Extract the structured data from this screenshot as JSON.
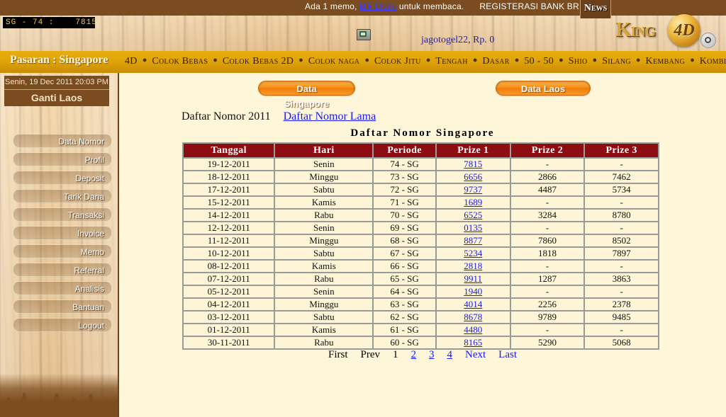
{
  "news": {
    "text_before": "Ada 1 memo, ",
    "link": "klik Disini",
    "text_after": " untuk membaca.",
    "marquee_extra": "REGISTERASI BANK BR",
    "badge": "News"
  },
  "ticker": {
    "label": "SG - 74 :",
    "value": "7815"
  },
  "account": {
    "user_info": "jagotogel22, Rp. 0"
  },
  "logo": {
    "text": "King",
    "badge": "4D"
  },
  "nav": {
    "pasaran": "Pasaran : Singapore",
    "items": [
      "4D",
      "Colok Bebas",
      "Colok Bebas 2D",
      "Colok naga",
      "Colok Jitu",
      "Tengah",
      "Dasar",
      "50 - 50",
      "Shio",
      "Silang",
      "Kembang",
      "Kombinasi"
    ]
  },
  "sidebar": {
    "date": "Senin, 19 Dec 2011 20:03 PM",
    "switch_label": "Ganti Laos",
    "items": [
      "Data Nomor",
      "Profil",
      "Deposit",
      "Tarik Dana",
      "Transaksi",
      "Invoice",
      "Memo",
      "Referral",
      "Analisis",
      "Bantuan",
      "Logout"
    ]
  },
  "tabs": {
    "singapore": "Data Singapore",
    "laos": "Data Laos"
  },
  "main": {
    "daftar_label": "Daftar Nomor 2011",
    "daftar_link": "Daftar Nomor Lama",
    "table_title": "Daftar  Nomor  Singapore"
  },
  "table": {
    "columns": [
      "Tanggal",
      "Hari",
      "Periode",
      "Prize 1",
      "Prize 2",
      "Prize 3"
    ],
    "rows": [
      {
        "tanggal": "19-12-2011",
        "hari": "Senin",
        "periode": "74 - SG",
        "prize1": "7815",
        "prize2": "-",
        "prize3": "-"
      },
      {
        "tanggal": "18-12-2011",
        "hari": "Minggu",
        "periode": "73 - SG",
        "prize1": "6656",
        "prize2": "2866",
        "prize3": "7462"
      },
      {
        "tanggal": "17-12-2011",
        "hari": "Sabtu",
        "periode": "72 - SG",
        "prize1": "9737",
        "prize2": "4487",
        "prize3": "5734"
      },
      {
        "tanggal": "15-12-2011",
        "hari": "Kamis",
        "periode": "71 - SG",
        "prize1": "1689",
        "prize2": "-",
        "prize3": "-"
      },
      {
        "tanggal": "14-12-2011",
        "hari": "Rabu",
        "periode": "70 - SG",
        "prize1": "6525",
        "prize2": "3284",
        "prize3": "8780"
      },
      {
        "tanggal": "12-12-2011",
        "hari": "Senin",
        "periode": "69 - SG",
        "prize1": "0135",
        "prize2": "-",
        "prize3": "-"
      },
      {
        "tanggal": "11-12-2011",
        "hari": "Minggu",
        "periode": "68 - SG",
        "prize1": "8877",
        "prize2": "7860",
        "prize3": "8502"
      },
      {
        "tanggal": "10-12-2011",
        "hari": "Sabtu",
        "periode": "67 - SG",
        "prize1": "5234",
        "prize2": "1818",
        "prize3": "7897"
      },
      {
        "tanggal": "08-12-2011",
        "hari": "Kamis",
        "periode": "66 - SG",
        "prize1": "2818",
        "prize2": "-",
        "prize3": "-"
      },
      {
        "tanggal": "07-12-2011",
        "hari": "Rabu",
        "periode": "65 - SG",
        "prize1": "9911",
        "prize2": "1287",
        "prize3": "3863"
      },
      {
        "tanggal": "05-12-2011",
        "hari": "Senin",
        "periode": "64 - SG",
        "prize1": "1940",
        "prize2": "-",
        "prize3": "-"
      },
      {
        "tanggal": "04-12-2011",
        "hari": "Minggu",
        "periode": "63 - SG",
        "prize1": "4014",
        "prize2": "2256",
        "prize3": "2378"
      },
      {
        "tanggal": "03-12-2011",
        "hari": "Sabtu",
        "periode": "62 - SG",
        "prize1": "8678",
        "prize2": "9789",
        "prize3": "9485"
      },
      {
        "tanggal": "01-12-2011",
        "hari": "Kamis",
        "periode": "61 - SG",
        "prize1": "4480",
        "prize2": "-",
        "prize3": "-"
      },
      {
        "tanggal": "30-11-2011",
        "hari": "Rabu",
        "periode": "60 - SG",
        "prize1": "8165",
        "prize2": "5290",
        "prize3": "5068"
      }
    ]
  },
  "pager": {
    "first": "First",
    "prev": "Prev",
    "pages": [
      "1",
      "2",
      "3",
      "4"
    ],
    "current": "1",
    "next": "Next",
    "last": "Last"
  },
  "colors": {
    "header_red": "#8d0d12",
    "nav_gold": "#e0a40a",
    "wood_brown": "#7b4c20",
    "link_blue": "#1a1aee",
    "page_cream": "#fdf6d8"
  }
}
